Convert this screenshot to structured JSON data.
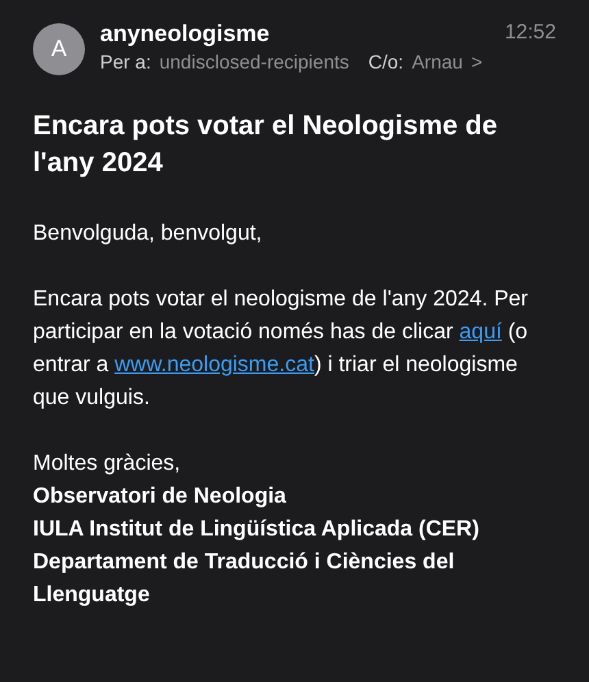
{
  "header": {
    "avatar": "A",
    "sender": "anyneologisme",
    "time": "12:52",
    "to_label": "Per a:",
    "to": "undisclosed-recipients",
    "cc_label": "C/o:",
    "cc": "Arnau",
    "chevron": ">"
  },
  "subject": "Encara pots votar el Neologisme de l'any 2024",
  "greeting": "Benvolguda, benvolgut,",
  "paragraph": [
    {
      "kind": "text",
      "text": "Encara pots votar el neologisme de l'any 2024. Per participar en la votació només has de clicar "
    },
    {
      "kind": "link",
      "text": "aquí"
    },
    {
      "kind": "text",
      "text": " (o entrar a "
    },
    {
      "kind": "link",
      "text": "www.neologisme.cat"
    },
    {
      "kind": "text",
      "text": ") i triar el neologisme que vulguis."
    }
  ],
  "signature": [
    {
      "text": "Moltes gràcies,",
      "bold": false
    },
    {
      "text": "Observatori de Neologia",
      "bold": true
    },
    {
      "text": "IULA Institut de Lingüística Aplicada (CER)",
      "bold": true
    },
    {
      "text": "Departament de Traducció i Ciències del Llenguatge",
      "bold": true
    }
  ]
}
